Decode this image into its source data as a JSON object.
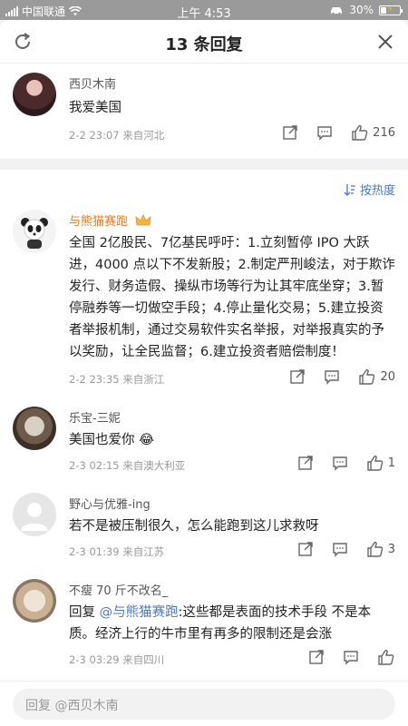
{
  "status_bar": {
    "carrier": "中国联通",
    "time": "上午 4:53",
    "battery": "30%",
    "battery_level": 0.3
  },
  "header": {
    "title": "13 条回复",
    "refresh_icon": "refresh-icon",
    "close_icon": "close-icon"
  },
  "root_comment": {
    "name": "西贝木南",
    "text": "我爱美国",
    "time": "2-2 23:07 来自河北",
    "likes": "216"
  },
  "sort": {
    "label": "按热度",
    "icon": "sort-icon"
  },
  "replies": [
    {
      "name": "与熊猫赛跑",
      "text": "全国 2亿股民、7亿基民呼吁：1.立刻暂停 IPO 大跃进，4000 点以下不发新股；2.制定严刑峻法，对于欺诈发行、财务造假、操纵市场等行为让其牢底坐穿；3.暂停融券等一切做空手段；4.停止量化交易；5.建立投资者举报机制，通过交易软件实名举报，对举报真实的予以奖励，让全民监督；6.建立投资者赔偿制度！",
      "time": "2-2 23:35 来自浙江",
      "likes": "20"
    },
    {
      "name": "乐宝-三妮",
      "text": "美国也爱你",
      "emoji": "😂",
      "time": "2-3 02:15 来自澳大利亚",
      "likes": "1"
    },
    {
      "name": "野心与优雅-ing",
      "text": "若不是被压制很久，怎么能跑到这儿求救呀",
      "time": "2-3 01:39 来自江苏",
      "likes": "3"
    },
    {
      "name": "不瘦 70 斤不改名_",
      "reply_prefix": "回复 ",
      "mention": "@与熊猫赛跑",
      "text": ":这些都是表面的技术手段 不是本质。经济上行的牛市里有再多的限制还是会涨",
      "time": "2-3 03:29 来自四川",
      "likes": ""
    }
  ],
  "input": {
    "placeholder": "回复 @西贝木南"
  },
  "colors": {
    "name_highlight": "#e87b1d",
    "link": "#4a78b5"
  }
}
